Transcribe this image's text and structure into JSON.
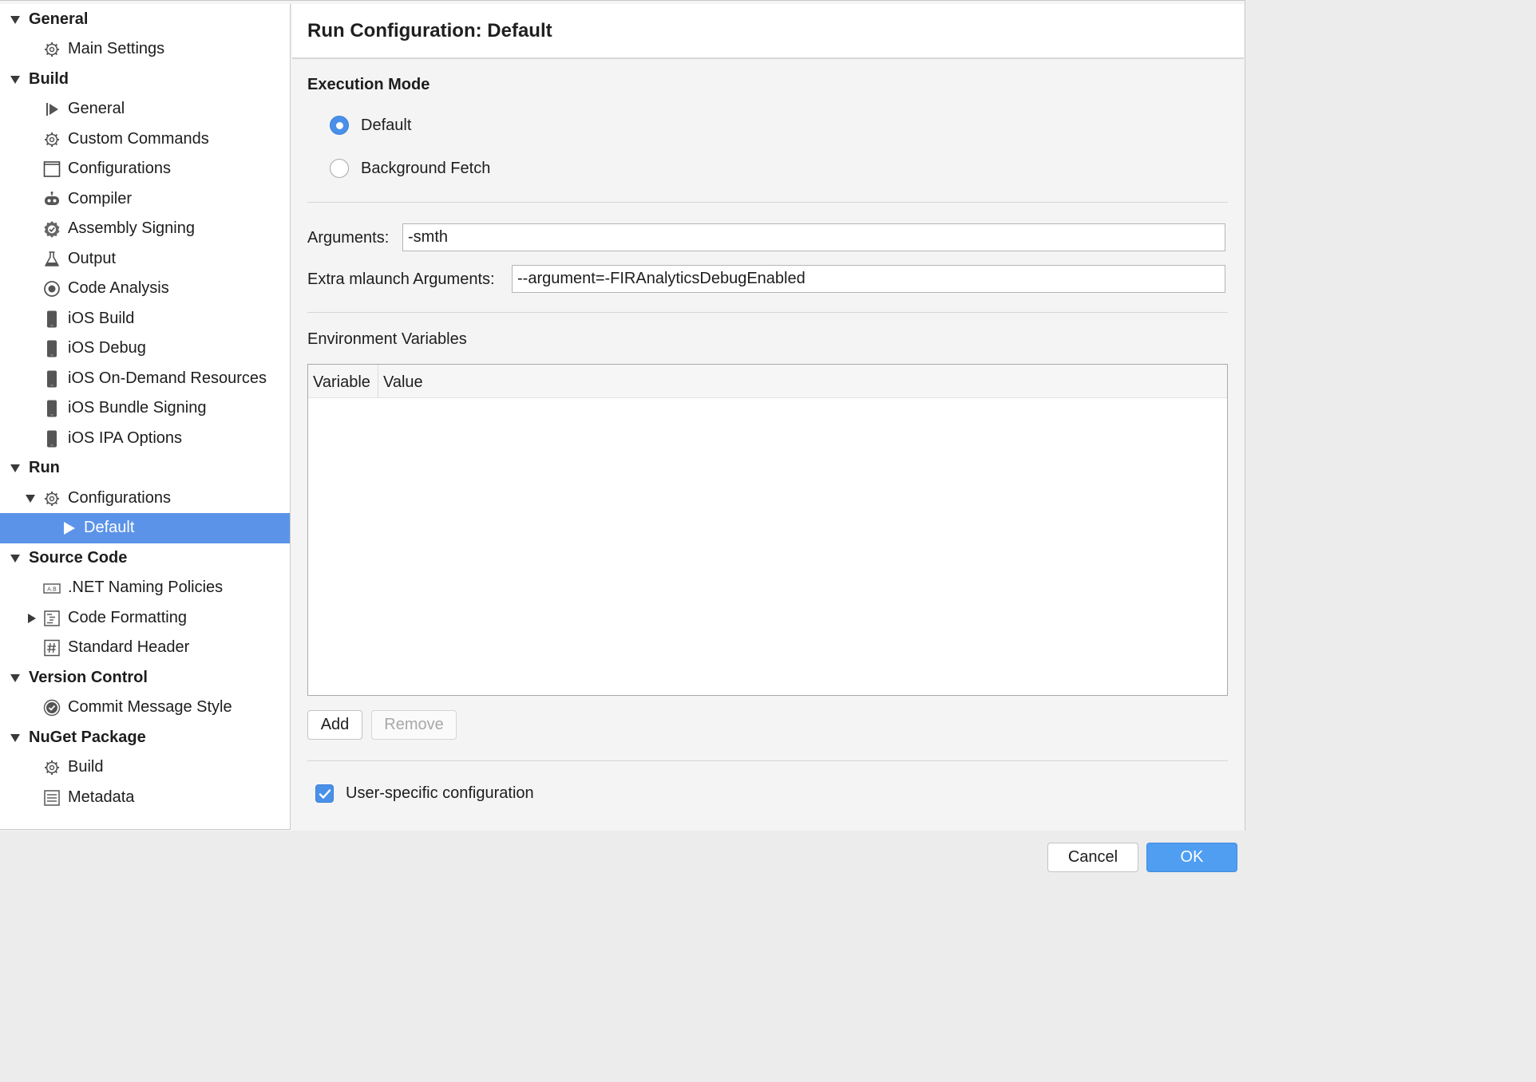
{
  "sidebar": {
    "rows": [
      {
        "label": "General",
        "kind": "group",
        "icon": "disclosure-down"
      },
      {
        "label": "Main Settings",
        "kind": "item",
        "icon": "gear-icon"
      },
      {
        "label": "Build",
        "kind": "group",
        "icon": "disclosure-down"
      },
      {
        "label": "General",
        "kind": "item",
        "icon": "play-bar-icon"
      },
      {
        "label": "Custom Commands",
        "kind": "item",
        "icon": "gear-icon"
      },
      {
        "label": "Configurations",
        "kind": "item",
        "icon": "window-icon"
      },
      {
        "label": "Compiler",
        "kind": "item",
        "icon": "robot-icon"
      },
      {
        "label": "Assembly Signing",
        "kind": "item",
        "icon": "seal-icon"
      },
      {
        "label": "Output",
        "kind": "item",
        "icon": "flask-icon"
      },
      {
        "label": "Code Analysis",
        "kind": "item",
        "icon": "target-icon"
      },
      {
        "label": "iOS Build",
        "kind": "item",
        "icon": "phone-icon"
      },
      {
        "label": "iOS Debug",
        "kind": "item",
        "icon": "phone-icon"
      },
      {
        "label": "iOS On-Demand Resources",
        "kind": "item",
        "icon": "phone-icon"
      },
      {
        "label": "iOS Bundle Signing",
        "kind": "item",
        "icon": "phone-icon"
      },
      {
        "label": "iOS IPA Options",
        "kind": "item",
        "icon": "phone-icon"
      },
      {
        "label": "Run",
        "kind": "group",
        "icon": "disclosure-down"
      },
      {
        "label": "Configurations",
        "kind": "subgroup",
        "icon": "gear-icon"
      },
      {
        "label": "Default",
        "kind": "selected",
        "icon": "play-icon"
      },
      {
        "label": "Source Code",
        "kind": "group",
        "icon": "disclosure-down"
      },
      {
        "label": ".NET Naming Policies",
        "kind": "item",
        "icon": "naming-icon"
      },
      {
        "label": "Code Formatting",
        "kind": "collapsed",
        "icon": "format-icon"
      },
      {
        "label": "Standard Header",
        "kind": "item",
        "icon": "hash-icon"
      },
      {
        "label": "Version Control",
        "kind": "group",
        "icon": "disclosure-down"
      },
      {
        "label": "Commit Message Style",
        "kind": "item",
        "icon": "check-circle-icon"
      },
      {
        "label": "NuGet Package",
        "kind": "group",
        "icon": "disclosure-down"
      },
      {
        "label": "Build",
        "kind": "item",
        "icon": "gear-icon"
      },
      {
        "label": "Metadata",
        "kind": "item",
        "icon": "document-icon"
      }
    ]
  },
  "header": {
    "title": "Run Configuration: Default"
  },
  "execution_mode": {
    "title": "Execution Mode",
    "options": [
      {
        "label": "Default",
        "selected": true
      },
      {
        "label": "Background Fetch",
        "selected": false
      }
    ]
  },
  "arguments": {
    "label": "Arguments:",
    "value": "-smth"
  },
  "mlaunch": {
    "label": "Extra mlaunch Arguments:",
    "value": "--argument=-FIRAnalyticsDebugEnabled"
  },
  "env": {
    "title": "Environment Variables",
    "columns": [
      "Variable",
      "Value"
    ],
    "add_label": "Add",
    "remove_label": "Remove"
  },
  "user_specific": {
    "label": "User-specific configuration",
    "checked": true
  },
  "footer": {
    "cancel_label": "Cancel",
    "ok_label": "OK"
  },
  "colors": {
    "accent": "#4a90e8",
    "selection": "#5b93e8"
  }
}
